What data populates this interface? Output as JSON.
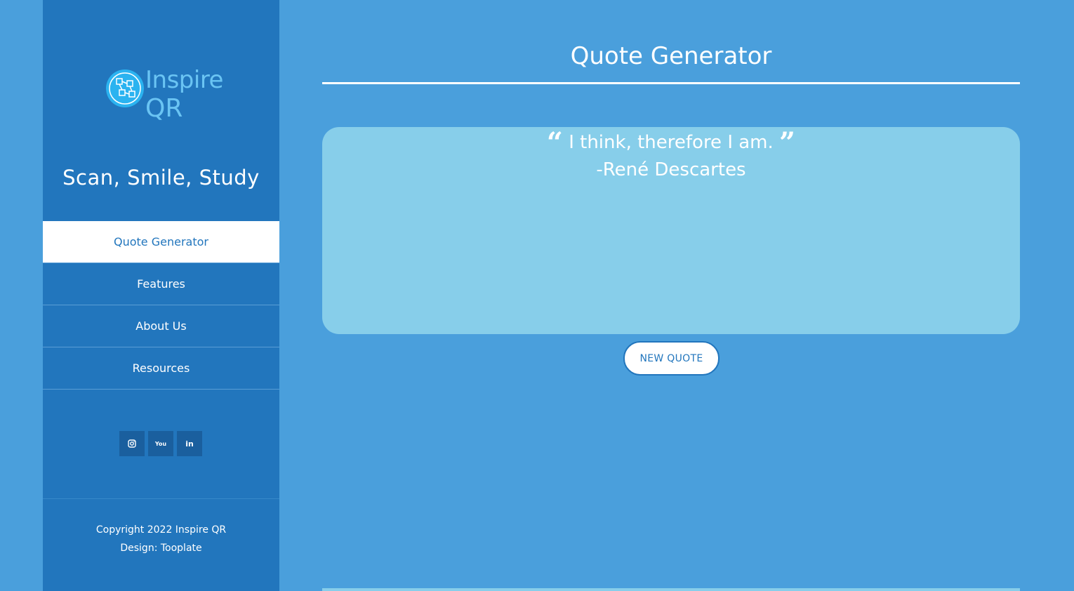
{
  "brand": {
    "logo_line1": "Inspire",
    "logo_line2": "QR",
    "tagline": "Scan, Smile, Study"
  },
  "nav": {
    "items": [
      {
        "label": "Quote Generator",
        "active": true
      },
      {
        "label": "Features",
        "active": false
      },
      {
        "label": "About Us",
        "active": false
      },
      {
        "label": "Resources",
        "active": false
      }
    ]
  },
  "social": {
    "icons": [
      "instagram-icon",
      "youtube-icon",
      "linkedin-icon"
    ],
    "youtube_glyph": "You",
    "linkedin_glyph": "in"
  },
  "footer": {
    "copyright": "Copyright 2022 Inspire QR",
    "design": "Design: Tooplate"
  },
  "main": {
    "title": "Quote Generator",
    "quote_text": "I think, therefore I am.",
    "quote_author": "-René Descartes",
    "new_quote_label": "NEW QUOTE"
  },
  "colors": {
    "page_bg": "#4a9fdc",
    "sidebar_bg": "#2276bd",
    "card_bg": "#87ceea",
    "logo_color": "#6ac4f3",
    "social_bg": "#1a5f9e"
  }
}
